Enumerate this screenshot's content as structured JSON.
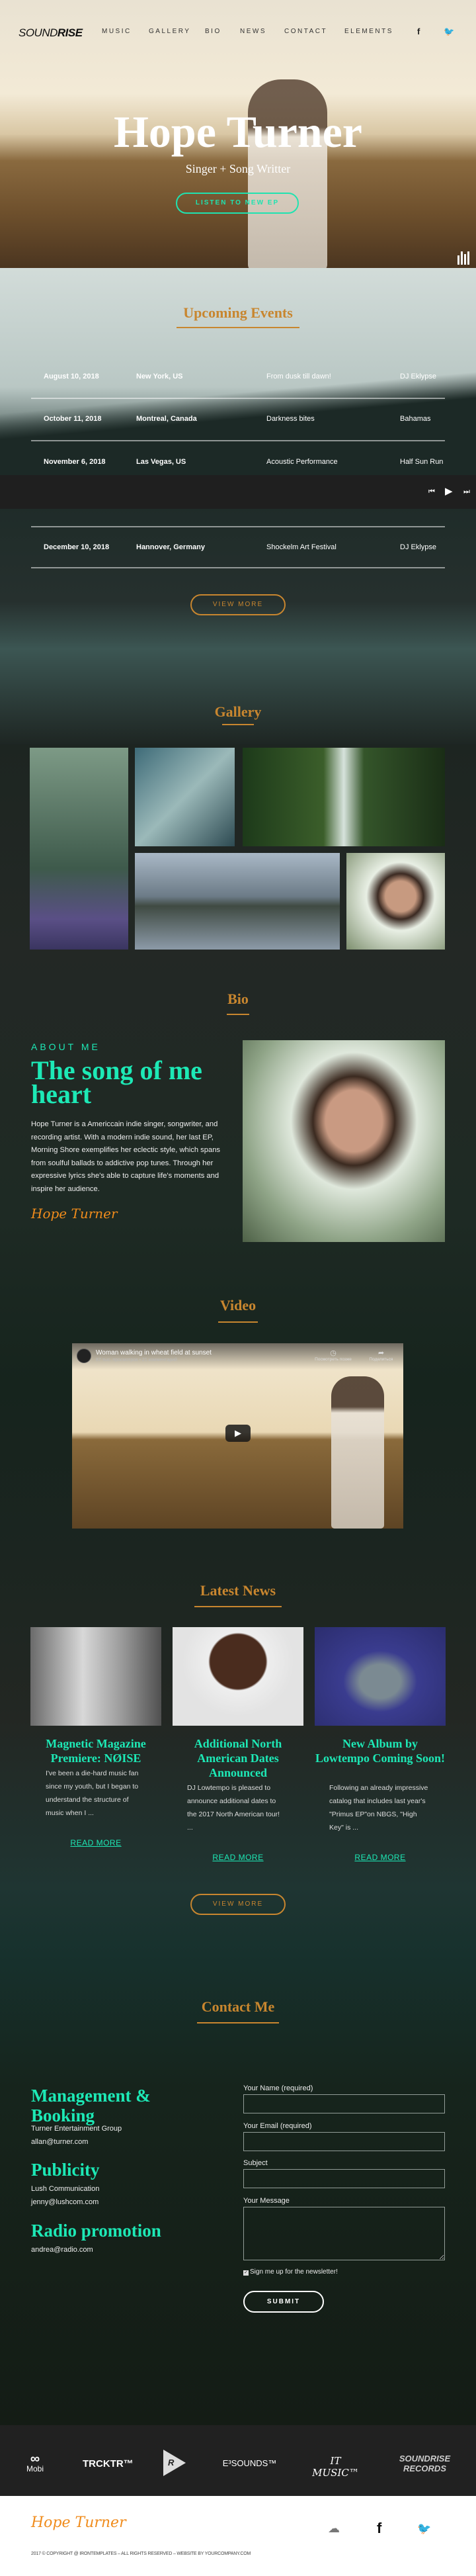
{
  "colors": {
    "accent_gold": "#c8862f",
    "accent_teal": "#1de9b6",
    "signature_orange": "#f08c1c"
  },
  "nav": {
    "logo_light": "SOUND",
    "logo_bold": "RISE",
    "items": [
      "MUSIC",
      "GALLERY",
      "BIO",
      "NEWS",
      "CONTACT",
      "ELEMENTS"
    ],
    "social": [
      "facebook-icon",
      "twitter-icon"
    ],
    "facebook": "f",
    "twitter": "t"
  },
  "hero": {
    "title": "Hope Turner",
    "subtitle": "Singer + Song Writter",
    "button": "LISTEN TO NEW EP"
  },
  "events": {
    "title": "Upcoming Events",
    "rows": [
      {
        "date": "August 10, 2018",
        "location": "New York, US",
        "event": "From dusk till dawn!",
        "artist": "DJ Eklypse"
      },
      {
        "date": "October 11, 2018",
        "location": "Montreal, Canada",
        "event": "Darkness bites",
        "artist": "Bahamas"
      },
      {
        "date": "November 6, 2018",
        "location": "Las Vegas, US",
        "event": "Acoustic Performance",
        "artist": "Half Sun Run"
      },
      {
        "date": "December 10, 2018",
        "location": "Hannover, Germany",
        "event": "Shockelm Art Festival",
        "artist": "DJ Eklypse"
      }
    ],
    "view_more": "VIEW MORE"
  },
  "player": {
    "prev": "⏮",
    "play": "▶",
    "next": "⏭"
  },
  "gallery": {
    "title": "Gallery"
  },
  "bio": {
    "title": "Bio",
    "eyebrow": "ABOUT ME",
    "heading": "The song of me heart",
    "paragraph": "Hope Turner is a Americcain indie singer, songwriter, and recording artist. With a modern indie sound, her last EP, Morning Shore exemplifies her eclectic style, which spans from soulful ballads to addictive pop tunes. Through her expressive lyrics she's able to capture life's moments and inspire her audience.",
    "signature": "Hope Turner"
  },
  "video": {
    "title": "Video",
    "video_title": "Woman walking in wheat field at sunset",
    "meta": "87 тыс. просмотров • 21 комментарий",
    "watch_later": "Посмотреть позже",
    "share": "Поделиться"
  },
  "news": {
    "title": "Latest News",
    "read_more": "READ MORE",
    "view_more": "VIEW MORE",
    "items": [
      {
        "title": "Magnetic Magazine Premiere: NØISE",
        "excerpt": "I've been a die-hard music fan since my youth, but I began to understand the structure of music when I ..."
      },
      {
        "title": "Additional North American Dates Announced",
        "excerpt": "DJ Lowtempo is pleased to announce additional dates to the 2017 North American tour! ..."
      },
      {
        "title": "New Album by Lowtempo Coming Soon!",
        "excerpt": "Following an already impressive catalog that includes last year's \"Primus EP\"on NBGS, \"High Key\" is ..."
      }
    ]
  },
  "contact": {
    "title": "Contact Me",
    "blocks": [
      {
        "heading": "Management & Booking",
        "lines": [
          "Turner Entertainment Group",
          "allan@turner.com"
        ]
      },
      {
        "heading": "Publicity",
        "lines": [
          "Lush Communication",
          "jenny@lushcom.com"
        ]
      },
      {
        "heading": "Radio promotion",
        "lines": [
          "andrea@radio.com"
        ]
      }
    ],
    "form": {
      "name_label": "Your Name (required)",
      "name_value": "",
      "email_label": "Your Email (required)",
      "email_value": "",
      "subject_label": "Subject",
      "subject_value": "",
      "message_label": "Your Message",
      "message_value": "",
      "newsletter_label": "Sign me up for the newsletter!",
      "newsletter_checked": true,
      "submit": "SUBMIT"
    }
  },
  "partners": [
    "Mobi",
    "TRCKTR™",
    "R",
    "E³SOUNDS™",
    "IT MUSIC™",
    "SOUNDRISE RECORDS"
  ],
  "footer": {
    "signature": "Hope Turner",
    "social": [
      "soundcloud-icon",
      "facebook-icon",
      "twitter-icon"
    ],
    "copyright": "2017 © COPYRIGHT @ IRONTEMPLATES – ALL RIGHTS RESERVED – WEBSITE BY YOURCOMPANY.COM"
  }
}
